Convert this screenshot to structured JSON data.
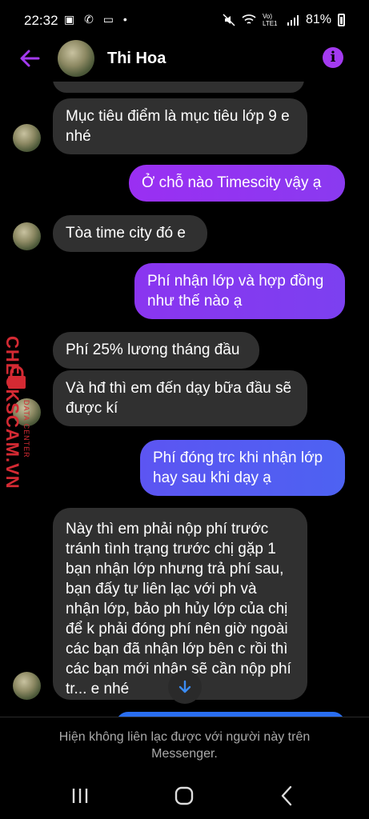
{
  "status": {
    "time": "22:32",
    "left_icons": "▣ ✆ ▭ •",
    "network": "Vo) LTE1",
    "battery": "81%"
  },
  "header": {
    "contact_name": "Thi Hoa",
    "info_glyph": "i",
    "accent_color": "#a33af0"
  },
  "messages": [
    {
      "dir": "in",
      "text": "Mục tiêu điểm là mục tiêu lớp 9 e nhé"
    },
    {
      "dir": "out",
      "text": "Ở chỗ nào Timescity vậy ạ"
    },
    {
      "dir": "in",
      "text": "Tòa time city đó e"
    },
    {
      "dir": "out",
      "text": "Phí nhận lớp và hợp đồng như thế nào ạ"
    },
    {
      "dir": "in",
      "text": "Phí 25% lương tháng đầu"
    },
    {
      "dir": "in",
      "text": "Và hđ thì em đến dạy bữa đầu sẽ được kí"
    },
    {
      "dir": "out",
      "text": "Phí đóng trc khi nhận lớp hay sau khi dạy ạ"
    },
    {
      "dir": "in",
      "text": "Này thì em phải nộp phí trước tránh tình trạng trước chị gặp 1 bạn nhận lớp nhưng trả phí sau, bạn đấy tự liên lạc với ph và nhận lớp, bảo ph hủy lớp của chị để k phải đóng phí nên giờ ngoài các bạn đã nhận lớp bên c rồi thì các bạn mới nhận sẽ cần nộp phí tr... e nhé"
    }
  ],
  "watermark": {
    "brand": "CHECKSCAM.VN",
    "sub": "DATA CENTER"
  },
  "notice": {
    "line1": "Hiện không liên lạc được với người này trên",
    "line2": "Messenger."
  },
  "icons": {
    "back": "arrow-left-icon",
    "info": "info-icon",
    "scroll": "arrow-down-icon",
    "recents": "recents-icon",
    "home": "home-icon",
    "navback": "chevron-left-icon"
  }
}
